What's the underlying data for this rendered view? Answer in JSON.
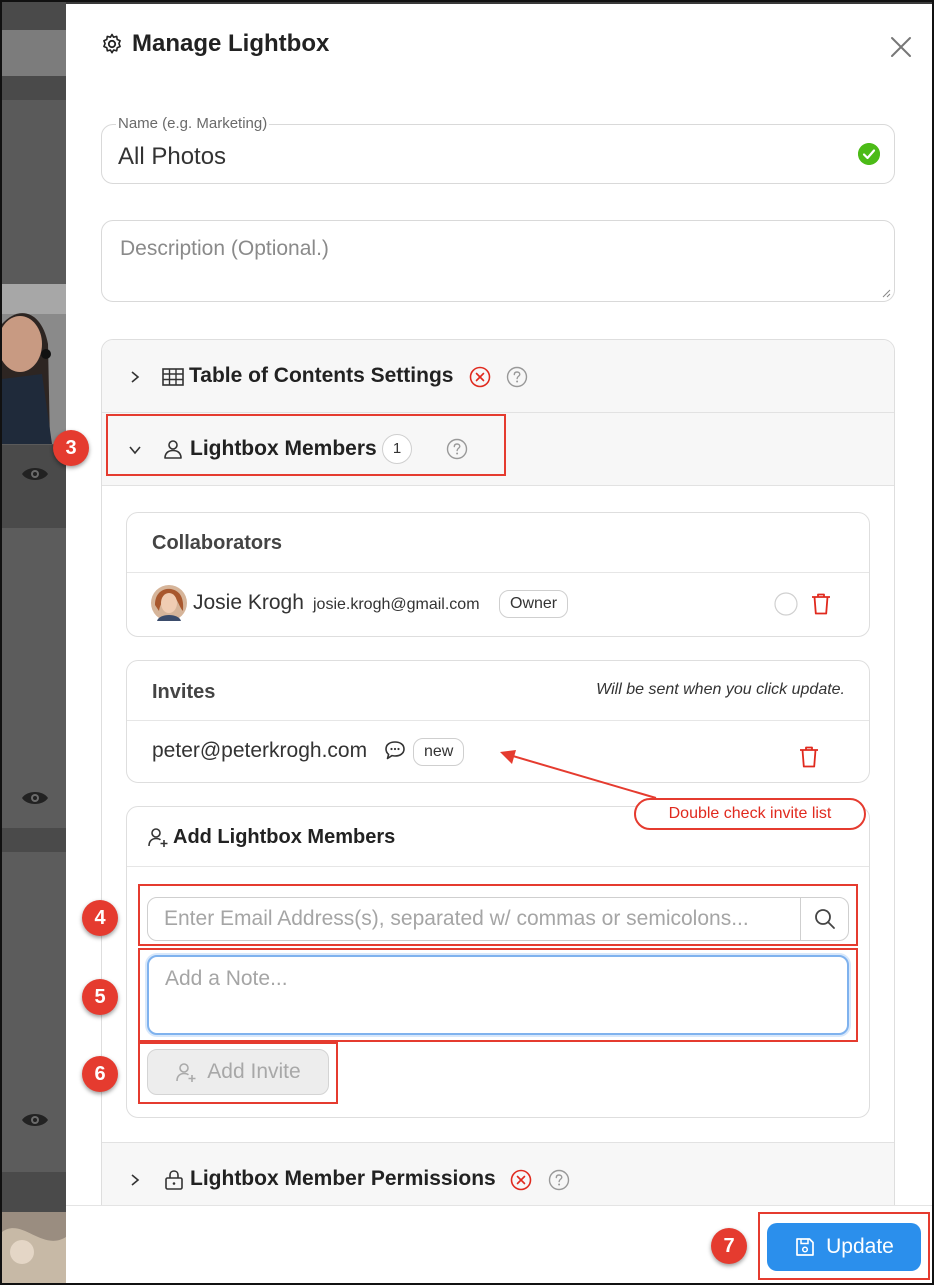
{
  "modal": {
    "title": "Manage Lightbox",
    "name_field": {
      "label": "Name (e.g. Marketing)",
      "value": "All Photos"
    },
    "description_field": {
      "placeholder": "Description (Optional.)"
    }
  },
  "sections": {
    "toc": {
      "title": "Table of Contents Settings"
    },
    "members": {
      "title": "Lightbox Members",
      "count": "1"
    },
    "permissions": {
      "title": "Lightbox Member Permissions"
    }
  },
  "collaborators": {
    "title": "Collaborators",
    "items": [
      {
        "name": "Josie Krogh",
        "email": "josie.krogh@gmail.com",
        "role": "Owner"
      }
    ]
  },
  "invites": {
    "title": "Invites",
    "note": "Will be sent when you click update.",
    "items": [
      {
        "email": "peter@peterkrogh.com",
        "badge": "new"
      }
    ]
  },
  "add_members": {
    "title": "Add Lightbox Members",
    "email_placeholder": "Enter Email Address(s), separated w/ commas or semicolons...",
    "note_placeholder": "Add a Note...",
    "add_invite_label": "Add Invite"
  },
  "footer": {
    "update_label": "Update"
  },
  "annotations": {
    "callout": "Double check invite list",
    "steps": [
      "3",
      "4",
      "5",
      "6",
      "7"
    ]
  },
  "colors": {
    "accent": "#2b8fec",
    "annotation": "#e53b2f",
    "success": "#4cbb17",
    "danger": "#e02a1e"
  }
}
